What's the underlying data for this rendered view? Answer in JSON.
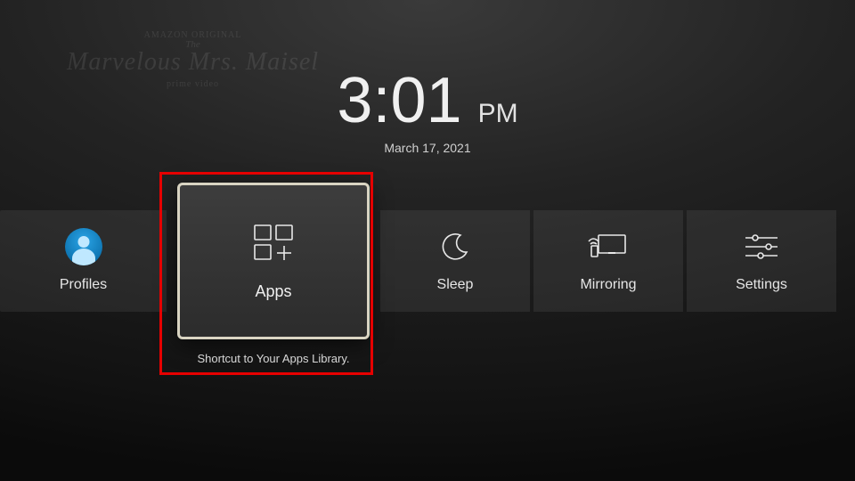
{
  "promo": {
    "line1": "AMAZON ORIGINAL",
    "line2": "The",
    "title": "Marvelous Mrs. Maisel",
    "sub": "prime video"
  },
  "clock": {
    "time": "3:01",
    "ampm": "PM",
    "date": "March 17, 2021"
  },
  "tiles": {
    "profiles": {
      "label": "Profiles"
    },
    "apps": {
      "label": "Apps",
      "caption": "Shortcut to Your Apps Library."
    },
    "sleep": {
      "label": "Sleep"
    },
    "mirroring": {
      "label": "Mirroring"
    },
    "settings": {
      "label": "Settings"
    }
  },
  "selected": "apps"
}
